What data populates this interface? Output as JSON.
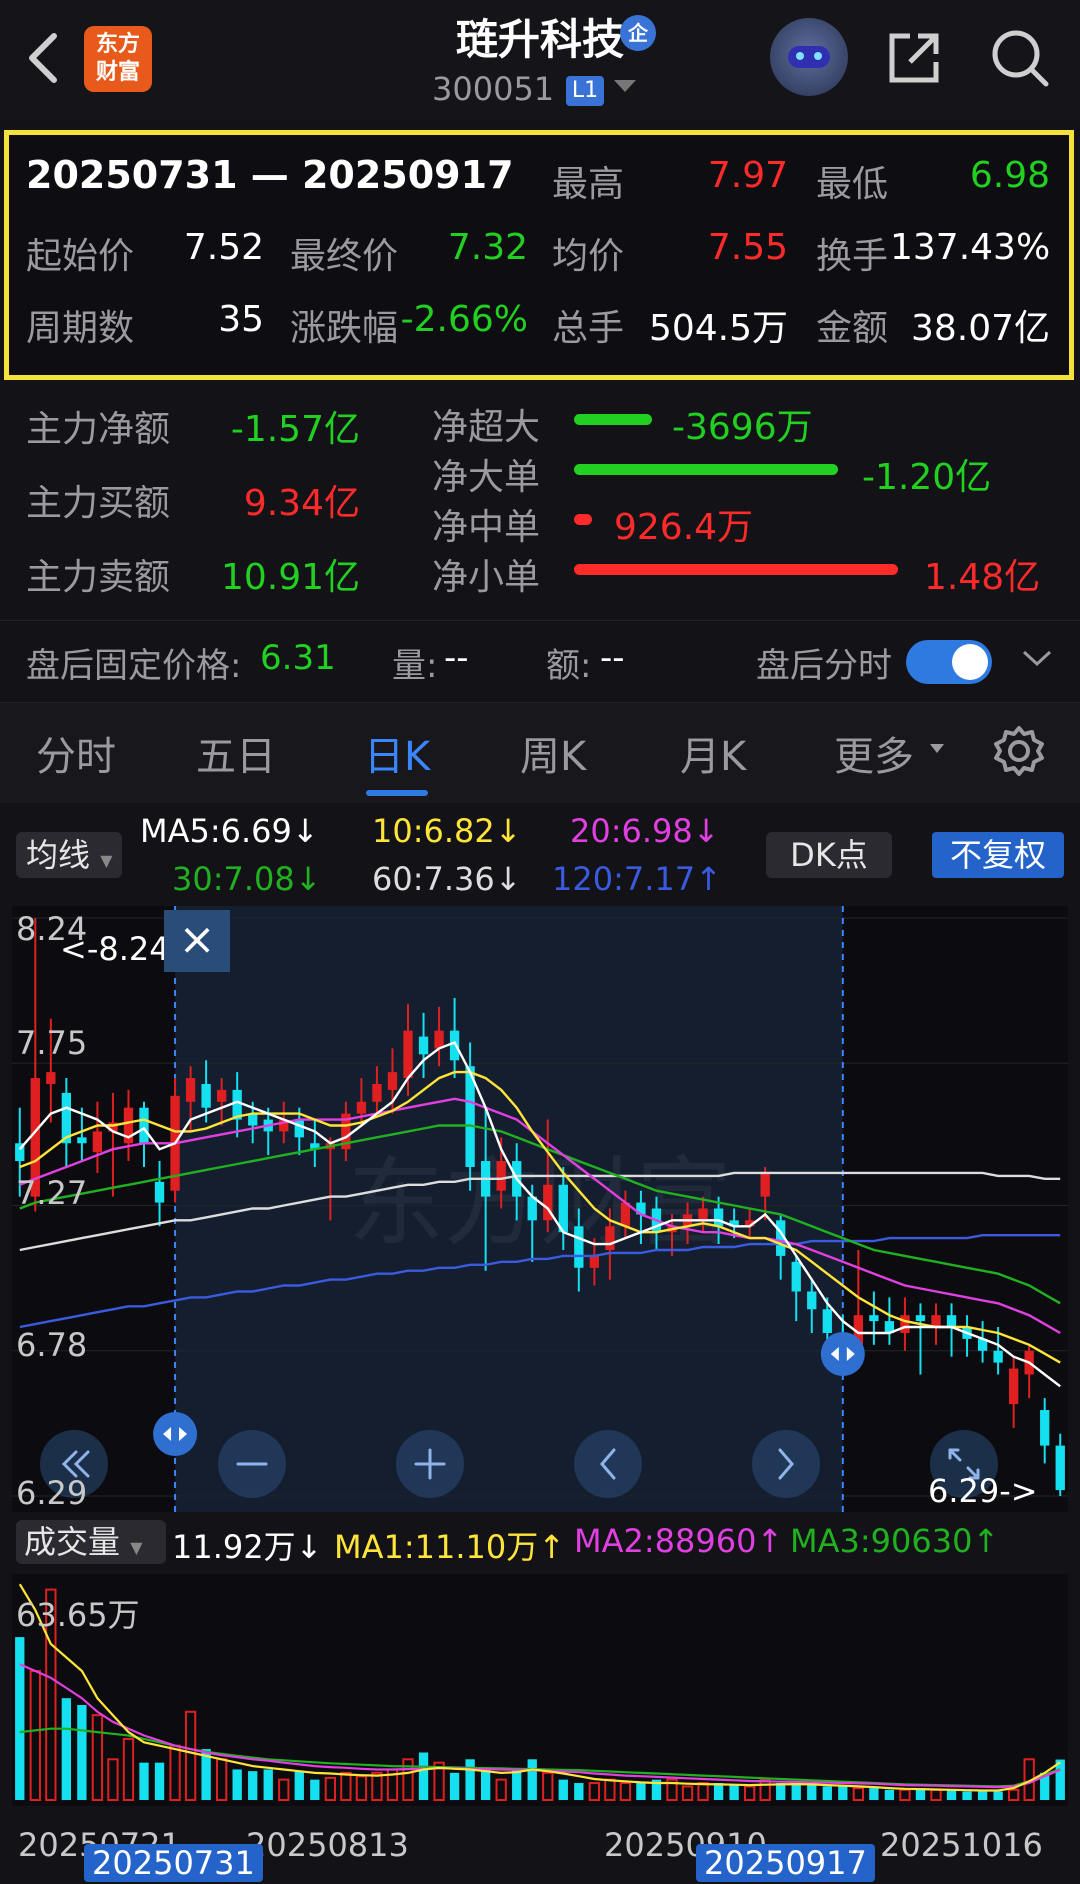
{
  "header": {
    "back_label": "back",
    "logo_text_line1": "东方",
    "logo_text_line2": "财富",
    "stock_name": "琏升科技",
    "name_badge": "企",
    "stock_code": "300051",
    "level_badge": "L1"
  },
  "summary": {
    "date_range": "20250731 — 20250917",
    "high_label": "最高",
    "high_value": "7.97",
    "low_label": "最低",
    "low_value": "6.98",
    "open_label": "起始价",
    "open_value": "7.52",
    "close_label": "最终价",
    "close_value": "7.32",
    "avg_label": "均价",
    "avg_value": "7.55",
    "turnover_label": "换手",
    "turnover_value": "137.43%",
    "periods_label": "周期数",
    "periods_value": "35",
    "change_label": "涨跌幅",
    "change_value": "-2.66%",
    "volume_label": "总手",
    "volume_value": "504.5万",
    "amount_label": "金额",
    "amount_value": "38.07亿"
  },
  "fund_flow": {
    "main_net_label": "主力净额",
    "main_net_value": "-1.57亿",
    "main_buy_label": "主力买额",
    "main_buy_value": "9.34亿",
    "main_sell_label": "主力卖额",
    "main_sell_value": "10.91亿",
    "xl_label": "净超大",
    "xl_value": "-3696万",
    "l_label": "净大单",
    "l_value": "-1.20亿",
    "m_label": "净中单",
    "m_value": "926.4万",
    "s_label": "净小单",
    "s_value": "1.48亿",
    "colors": {
      "positive": "#ff2b2b",
      "negative": "#22d022"
    }
  },
  "after_hours": {
    "price_label": "盘后固定价格:",
    "price_value": "6.31",
    "vol_label": "量:",
    "vol_value": "--",
    "amt_label": "额:",
    "amt_value": "--",
    "toggle_label": "盘后分时",
    "toggle_on": true
  },
  "tabs": [
    {
      "label": "分时"
    },
    {
      "label": "五日"
    },
    {
      "label": "日K",
      "active": true
    },
    {
      "label": "周K"
    },
    {
      "label": "月K"
    },
    {
      "label": "更多"
    }
  ],
  "ma_bar": {
    "dropdown": "均线",
    "ma5": "MA5:6.69↓",
    "ma10": "10:6.82↓",
    "ma20": "20:6.98↓",
    "ma30": "30:7.08↓",
    "ma60": "60:7.36↓",
    "ma120": "120:7.17↑",
    "dk_button": "DK点",
    "adjust_button": "不复权",
    "colors": {
      "ma5": "#ffffff",
      "ma10": "#ffe53a",
      "ma20": "#e040e0",
      "ma30": "#20b020",
      "ma60": "#dddddd",
      "ma120": "#3a5be0"
    }
  },
  "kline": {
    "y_labels": [
      "8.24",
      "7.75",
      "7.27",
      "6.78",
      "6.29"
    ],
    "max_marker": "<-8.24",
    "min_marker": "6.29->",
    "close_icon": "×",
    "watermark": "东方财富"
  },
  "volume_bar": {
    "dropdown": "成交量",
    "value": "11.92万↓",
    "ma1": "MA1:11.10万↑",
    "ma2": "MA2:88960↑",
    "ma3": "MA3:90630↑",
    "top_label": "63.65万"
  },
  "x_axis": {
    "d1": "20250721",
    "d2": "20250813",
    "d3": "20250910",
    "d4": "20251016",
    "sel_start": "20250731",
    "sel_end": "20250917"
  },
  "chart_data": {
    "type": "candlestick",
    "y_range": [
      6.29,
      8.24
    ],
    "colors": {
      "up": "#e02020",
      "down": "#14e0f0"
    },
    "candles": [
      {
        "o": 7.48,
        "c": 7.42,
        "h": 7.6,
        "l": 7.3
      },
      {
        "o": 7.3,
        "c": 7.7,
        "h": 8.24,
        "l": 7.25
      },
      {
        "o": 7.68,
        "c": 7.72,
        "h": 7.9,
        "l": 7.55
      },
      {
        "o": 7.65,
        "c": 7.48,
        "h": 7.7,
        "l": 7.4
      },
      {
        "o": 7.5,
        "c": 7.48,
        "h": 7.6,
        "l": 7.42
      },
      {
        "o": 7.45,
        "c": 7.52,
        "h": 7.62,
        "l": 7.38
      },
      {
        "o": 7.52,
        "c": 7.55,
        "h": 7.65,
        "l": 7.3
      },
      {
        "o": 7.48,
        "c": 7.6,
        "h": 7.66,
        "l": 7.42
      },
      {
        "o": 7.6,
        "c": 7.48,
        "h": 7.62,
        "l": 7.4
      },
      {
        "o": 7.35,
        "c": 7.28,
        "h": 7.42,
        "l": 7.2
      },
      {
        "o": 7.32,
        "c": 7.64,
        "h": 7.7,
        "l": 7.28
      },
      {
        "o": 7.62,
        "c": 7.7,
        "h": 7.74,
        "l": 7.52
      },
      {
        "o": 7.68,
        "c": 7.6,
        "h": 7.76,
        "l": 7.55
      },
      {
        "o": 7.62,
        "c": 7.66,
        "h": 7.7,
        "l": 7.54
      },
      {
        "o": 7.66,
        "c": 7.56,
        "h": 7.72,
        "l": 7.5
      },
      {
        "o": 7.58,
        "c": 7.54,
        "h": 7.62,
        "l": 7.48
      },
      {
        "o": 7.56,
        "c": 7.52,
        "h": 7.6,
        "l": 7.44
      },
      {
        "o": 7.52,
        "c": 7.56,
        "h": 7.62,
        "l": 7.48
      },
      {
        "o": 7.56,
        "c": 7.5,
        "h": 7.6,
        "l": 7.44
      },
      {
        "o": 7.48,
        "c": 7.46,
        "h": 7.56,
        "l": 7.4
      },
      {
        "o": 7.46,
        "c": 7.48,
        "h": 7.5,
        "l": 7.22
      },
      {
        "o": 7.46,
        "c": 7.58,
        "h": 7.62,
        "l": 7.42
      },
      {
        "o": 7.58,
        "c": 7.62,
        "h": 7.7,
        "l": 7.54
      },
      {
        "o": 7.62,
        "c": 7.68,
        "h": 7.74,
        "l": 7.58
      },
      {
        "o": 7.66,
        "c": 7.72,
        "h": 7.8,
        "l": 7.58
      },
      {
        "o": 7.7,
        "c": 7.86,
        "h": 7.95,
        "l": 7.64
      },
      {
        "o": 7.84,
        "c": 7.78,
        "h": 7.92,
        "l": 7.7
      },
      {
        "o": 7.8,
        "c": 7.86,
        "h": 7.94,
        "l": 7.74
      },
      {
        "o": 7.86,
        "c": 7.76,
        "h": 7.97,
        "l": 7.7
      },
      {
        "o": 7.74,
        "c": 7.4,
        "h": 7.82,
        "l": 7.32
      },
      {
        "o": 7.42,
        "c": 7.3,
        "h": 7.6,
        "l": 7.05
      },
      {
        "o": 7.32,
        "c": 7.42,
        "h": 7.5,
        "l": 7.26
      },
      {
        "o": 7.42,
        "c": 7.3,
        "h": 7.48,
        "l": 7.22
      },
      {
        "o": 7.3,
        "c": 7.22,
        "h": 7.34,
        "l": 7.08
      },
      {
        "o": 7.22,
        "c": 7.34,
        "h": 7.56,
        "l": 7.18
      },
      {
        "o": 7.34,
        "c": 7.18,
        "h": 7.4,
        "l": 7.12
      },
      {
        "o": 7.2,
        "c": 7.06,
        "h": 7.26,
        "l": 6.98
      },
      {
        "o": 7.06,
        "c": 7.1,
        "h": 7.16,
        "l": 7.0
      },
      {
        "o": 7.12,
        "c": 7.2,
        "h": 7.26,
        "l": 7.02
      },
      {
        "o": 7.2,
        "c": 7.28,
        "h": 7.32,
        "l": 7.16
      },
      {
        "o": 7.28,
        "c": 7.24,
        "h": 7.32,
        "l": 7.14
      },
      {
        "o": 7.26,
        "c": 7.18,
        "h": 7.3,
        "l": 7.12
      },
      {
        "o": 7.18,
        "c": 7.2,
        "h": 7.24,
        "l": 7.1
      },
      {
        "o": 7.2,
        "c": 7.24,
        "h": 7.28,
        "l": 7.14
      },
      {
        "o": 7.22,
        "c": 7.26,
        "h": 7.3,
        "l": 7.18
      },
      {
        "o": 7.26,
        "c": 7.2,
        "h": 7.3,
        "l": 7.14
      },
      {
        "o": 7.22,
        "c": 7.2,
        "h": 7.26,
        "l": 7.16
      },
      {
        "o": 7.2,
        "c": 7.22,
        "h": 7.26,
        "l": 7.16
      },
      {
        "o": 7.3,
        "c": 7.38,
        "h": 7.4,
        "l": 7.22
      },
      {
        "o": 7.22,
        "c": 7.1,
        "h": 7.24,
        "l": 7.02
      },
      {
        "o": 7.08,
        "c": 6.98,
        "h": 7.1,
        "l": 6.88
      },
      {
        "o": 6.98,
        "c": 6.92,
        "h": 7.02,
        "l": 6.84
      },
      {
        "o": 6.92,
        "c": 6.84,
        "h": 6.96,
        "l": 6.78
      },
      {
        "o": 6.84,
        "c": 6.76,
        "h": 6.9,
        "l": 6.72
      },
      {
        "o": 6.76,
        "c": 6.9,
        "h": 7.12,
        "l": 6.74
      },
      {
        "o": 6.9,
        "c": 6.88,
        "h": 6.98,
        "l": 6.8
      },
      {
        "o": 6.88,
        "c": 6.84,
        "h": 6.96,
        "l": 6.8
      },
      {
        "o": 6.84,
        "c": 6.9,
        "h": 6.96,
        "l": 6.78
      },
      {
        "o": 6.9,
        "c": 6.88,
        "h": 6.94,
        "l": 6.7
      },
      {
        "o": 6.86,
        "c": 6.9,
        "h": 6.94,
        "l": 6.8
      },
      {
        "o": 6.9,
        "c": 6.86,
        "h": 6.94,
        "l": 6.76
      },
      {
        "o": 6.86,
        "c": 6.82,
        "h": 6.9,
        "l": 6.76
      },
      {
        "o": 6.82,
        "c": 6.78,
        "h": 6.88,
        "l": 6.74
      },
      {
        "o": 6.78,
        "c": 6.74,
        "h": 6.86,
        "l": 6.7
      },
      {
        "o": 6.6,
        "c": 6.72,
        "h": 6.76,
        "l": 6.52
      },
      {
        "o": 6.7,
        "c": 6.78,
        "h": 6.8,
        "l": 6.62
      },
      {
        "o": 6.58,
        "c": 6.46,
        "h": 6.62,
        "l": 6.4
      },
      {
        "o": 6.46,
        "c": 6.31,
        "h": 6.5,
        "l": 6.29
      }
    ],
    "ma5": [
      7.46,
      7.52,
      7.58,
      7.6,
      7.58,
      7.56,
      7.52,
      7.5,
      7.53,
      7.46,
      7.48,
      7.56,
      7.58,
      7.6,
      7.62,
      7.6,
      7.58,
      7.56,
      7.54,
      7.52,
      7.48,
      7.5,
      7.54,
      7.58,
      7.62,
      7.7,
      7.76,
      7.8,
      7.82,
      7.72,
      7.6,
      7.46,
      7.36,
      7.3,
      7.26,
      7.18,
      7.16,
      7.14,
      7.14,
      7.16,
      7.18,
      7.2,
      7.22,
      7.22,
      7.22,
      7.22,
      7.2,
      7.2,
      7.24,
      7.18,
      7.1,
      7.02,
      6.94,
      6.88,
      6.84,
      6.84,
      6.84,
      6.86,
      6.86,
      6.86,
      6.86,
      6.84,
      6.82,
      6.8,
      6.76,
      6.74,
      6.7,
      6.66
    ],
    "ma10": [
      7.4,
      7.42,
      7.46,
      7.5,
      7.52,
      7.54,
      7.54,
      7.55,
      7.56,
      7.54,
      7.52,
      7.52,
      7.53,
      7.55,
      7.57,
      7.58,
      7.58,
      7.58,
      7.58,
      7.56,
      7.54,
      7.54,
      7.55,
      7.57,
      7.59,
      7.62,
      7.66,
      7.7,
      7.72,
      7.72,
      7.7,
      7.66,
      7.6,
      7.52,
      7.45,
      7.38,
      7.32,
      7.26,
      7.22,
      7.2,
      7.18,
      7.18,
      7.19,
      7.2,
      7.21,
      7.2,
      7.18,
      7.16,
      7.16,
      7.14,
      7.12,
      7.08,
      7.04,
      7.0,
      6.96,
      6.93,
      6.9,
      6.88,
      6.87,
      6.86,
      6.86,
      6.86,
      6.85,
      6.84,
      6.82,
      6.8,
      6.77,
      6.74
    ],
    "ma20": [
      7.34,
      7.36,
      7.38,
      7.4,
      7.42,
      7.44,
      7.46,
      7.47,
      7.48,
      7.48,
      7.48,
      7.49,
      7.5,
      7.51,
      7.52,
      7.53,
      7.54,
      7.55,
      7.56,
      7.56,
      7.56,
      7.56,
      7.57,
      7.58,
      7.59,
      7.6,
      7.61,
      7.62,
      7.63,
      7.62,
      7.6,
      7.58,
      7.56,
      7.52,
      7.48,
      7.44,
      7.4,
      7.36,
      7.32,
      7.28,
      7.24,
      7.22,
      7.2,
      7.19,
      7.18,
      7.18,
      7.17,
      7.16,
      7.16,
      7.15,
      7.14,
      7.12,
      7.1,
      7.08,
      7.06,
      7.04,
      7.02,
      7.0,
      6.99,
      6.98,
      6.97,
      6.96,
      6.95,
      6.94,
      6.92,
      6.9,
      6.87,
      6.84
    ],
    "ma30": [
      7.26,
      7.28,
      7.29,
      7.3,
      7.31,
      7.32,
      7.33,
      7.34,
      7.35,
      7.36,
      7.37,
      7.38,
      7.39,
      7.4,
      7.41,
      7.42,
      7.43,
      7.44,
      7.45,
      7.46,
      7.47,
      7.48,
      7.49,
      7.5,
      7.51,
      7.52,
      7.53,
      7.54,
      7.54,
      7.54,
      7.53,
      7.52,
      7.5,
      7.48,
      7.46,
      7.44,
      7.42,
      7.4,
      7.38,
      7.36,
      7.34,
      7.32,
      7.31,
      7.3,
      7.29,
      7.28,
      7.27,
      7.26,
      7.25,
      7.24,
      7.22,
      7.2,
      7.18,
      7.16,
      7.14,
      7.12,
      7.11,
      7.1,
      7.09,
      7.08,
      7.07,
      7.06,
      7.05,
      7.04,
      7.02,
      7.0,
      6.97,
      6.94
    ],
    "ma60": [
      7.12,
      7.13,
      7.14,
      7.15,
      7.16,
      7.17,
      7.18,
      7.19,
      7.2,
      7.21,
      7.22,
      7.22,
      7.23,
      7.24,
      7.25,
      7.26,
      7.26,
      7.27,
      7.28,
      7.29,
      7.3,
      7.3,
      7.31,
      7.32,
      7.33,
      7.34,
      7.34,
      7.35,
      7.35,
      7.36,
      7.36,
      7.36,
      7.37,
      7.37,
      7.37,
      7.37,
      7.37,
      7.37,
      7.37,
      7.37,
      7.37,
      7.37,
      7.37,
      7.37,
      7.37,
      7.37,
      7.38,
      7.38,
      7.38,
      7.38,
      7.38,
      7.38,
      7.38,
      7.38,
      7.38,
      7.38,
      7.38,
      7.38,
      7.38,
      7.38,
      7.38,
      7.38,
      7.38,
      7.37,
      7.37,
      7.37,
      7.36,
      7.36
    ],
    "ma120": [
      6.86,
      6.87,
      6.88,
      6.89,
      6.9,
      6.91,
      6.92,
      6.93,
      6.93,
      6.94,
      6.95,
      6.96,
      6.96,
      6.97,
      6.98,
      6.98,
      6.99,
      7.0,
      7.0,
      7.01,
      7.02,
      7.02,
      7.03,
      7.04,
      7.04,
      7.05,
      7.05,
      7.06,
      7.06,
      7.07,
      7.07,
      7.08,
      7.08,
      7.09,
      7.09,
      7.1,
      7.1,
      7.1,
      7.11,
      7.11,
      7.11,
      7.12,
      7.12,
      7.12,
      7.13,
      7.13,
      7.13,
      7.14,
      7.14,
      7.14,
      7.14,
      7.15,
      7.15,
      7.15,
      7.15,
      7.15,
      7.16,
      7.16,
      7.16,
      7.16,
      7.16,
      7.16,
      7.17,
      7.17,
      7.17,
      7.17,
      7.17,
      7.17
    ],
    "volume": {
      "max": 636500,
      "values": [
        480000,
        380000,
        620000,
        300000,
        280000,
        250000,
        120000,
        180000,
        110000,
        110000,
        160000,
        260000,
        150000,
        120000,
        90000,
        85000,
        90000,
        60000,
        85000,
        60000,
        65000,
        80000,
        70000,
        80000,
        90000,
        120000,
        140000,
        110000,
        80000,
        120000,
        90000,
        60000,
        90000,
        120000,
        80000,
        60000,
        50000,
        50000,
        60000,
        50000,
        50000,
        60000,
        60000,
        40000,
        50000,
        50000,
        45000,
        40000,
        60000,
        50000,
        50000,
        45000,
        40000,
        40000,
        35000,
        35000,
        30000,
        30000,
        35000,
        30000,
        30000,
        25000,
        25000,
        25000,
        30000,
        120000,
        80000,
        119200
      ],
      "ma1": [
        636000,
        560000,
        460000,
        420000,
        380000,
        300000,
        250000,
        200000,
        170000,
        160000,
        150000,
        140000,
        130000,
        120000,
        110000,
        100000,
        95000,
        90000,
        85000,
        80000,
        78000,
        75000,
        73000,
        72000,
        75000,
        80000,
        90000,
        95000,
        92000,
        90000,
        85000,
        80000,
        82000,
        90000,
        85000,
        78000,
        70000,
        62000,
        58000,
        55000,
        52000,
        50000,
        50000,
        48000,
        47000,
        46000,
        45000,
        44000,
        45000,
        46000,
        47000,
        46000,
        44000,
        42000,
        40000,
        38000,
        35000,
        33000,
        32000,
        31000,
        30000,
        29000,
        28000,
        28000,
        35000,
        55000,
        80000,
        111000
      ],
      "ma2": [
        400000,
        380000,
        360000,
        330000,
        300000,
        260000,
        230000,
        210000,
        190000,
        175000,
        160000,
        150000,
        140000,
        132000,
        126000,
        120000,
        116000,
        110000,
        105000,
        100000,
        97000,
        95000,
        92000,
        90000,
        90000,
        91000,
        92000,
        93000,
        93000,
        92000,
        91000,
        90000,
        89000,
        88000,
        86000,
        84000,
        82000,
        78000,
        75000,
        72000,
        70000,
        68000,
        66000,
        64000,
        62000,
        60000,
        58000,
        56000,
        55000,
        54000,
        53000,
        52000,
        51000,
        50000,
        49000,
        48000,
        46000,
        44000,
        43000,
        42000,
        41000,
        40000,
        39000,
        38000,
        40000,
        50000,
        70000,
        88960
      ],
      "ma3": [
        200000,
        205000,
        210000,
        210000,
        205000,
        200000,
        195000,
        190000,
        180000,
        170000,
        160000,
        150000,
        142000,
        136000,
        130000,
        125000,
        120000,
        117000,
        114000,
        111000,
        108000,
        106000,
        104000,
        102000,
        100000,
        99000,
        98000,
        97000,
        96000,
        95000,
        94000,
        93000,
        92000,
        91000,
        90000,
        89000,
        88000,
        86000,
        84000,
        82000,
        80000,
        78000,
        76000,
        74000,
        72000,
        70000,
        68000,
        66000,
        64000,
        62000,
        60000,
        58000,
        56000,
        54000,
        52000,
        50000,
        48000,
        46000,
        45000,
        44000,
        43000,
        42000,
        41000,
        40000,
        42000,
        55000,
        75000,
        90630
      ]
    }
  }
}
